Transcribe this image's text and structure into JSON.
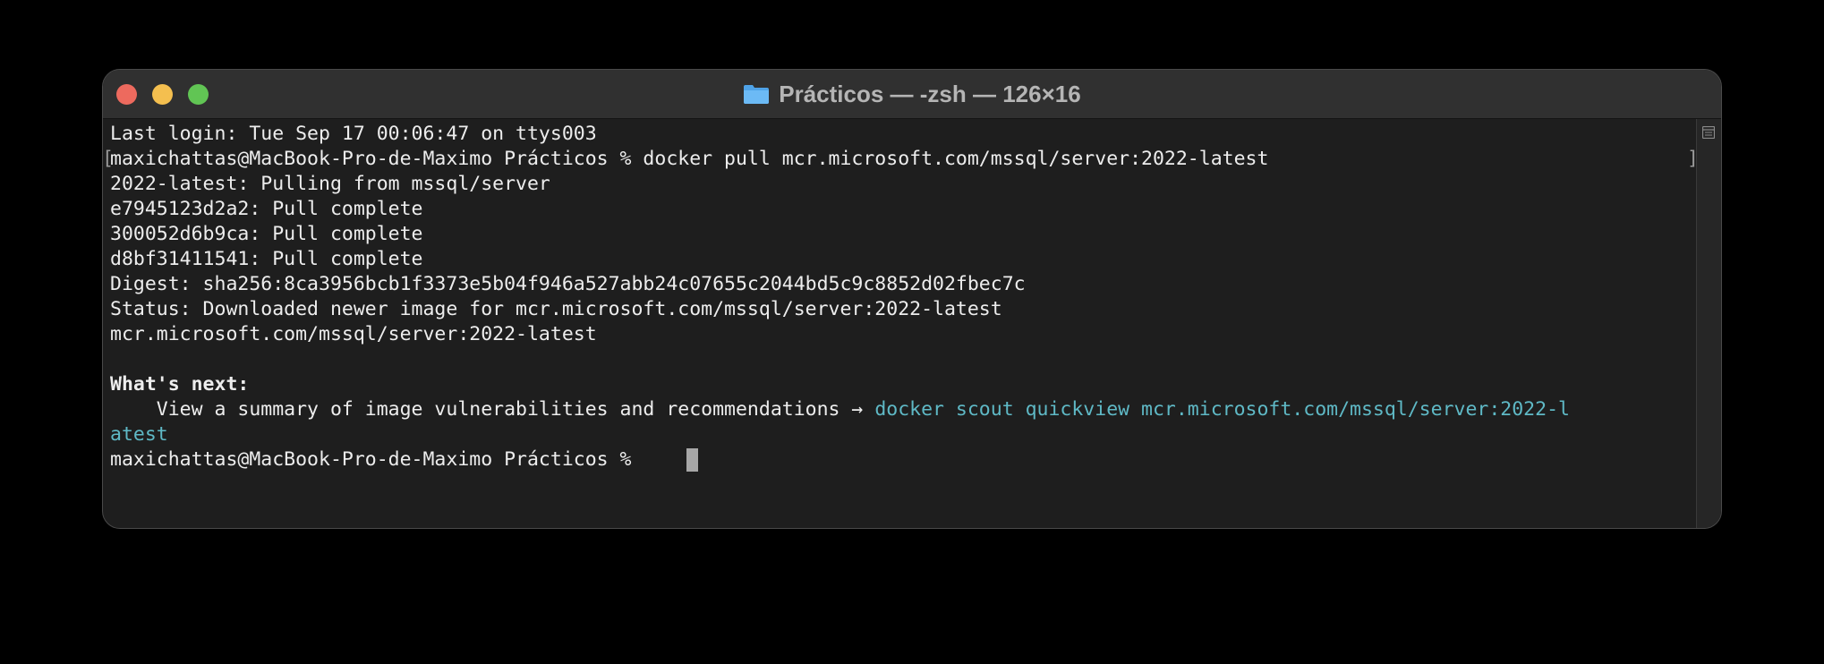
{
  "window": {
    "title": "Prácticos — -zsh — 126×16",
    "title_icon": "folder-icon"
  },
  "terminal": {
    "last_login": "Last login: Tue Sep 17 00:06:47 on ttys003",
    "command_line": "maxichattas@MacBook-Pro-de-Maximo Prácticos % docker pull mcr.microsoft.com/mssql/server:2022-latest",
    "output": [
      "2022-latest: Pulling from mssql/server",
      "e7945123d2a2: Pull complete",
      "300052d6b9ca: Pull complete",
      "d8bf31411541: Pull complete",
      "Digest: sha256:8ca3956bcb1f3373e5b04f946a527abb24c07655c2044bd5c9c8852d02fbec7c",
      "Status: Downloaded newer image for mcr.microsoft.com/mssql/server:2022-latest",
      "mcr.microsoft.com/mssql/server:2022-latest"
    ],
    "whats_next_heading": "What's next:",
    "hint_text": "    View a summary of image vulnerabilities and recommendations → ",
    "hint_command_part1": "docker scout quickview mcr.microsoft.com/mssql/server:2022-l",
    "hint_command_part2": "atest",
    "prompt": "maxichattas@MacBook-Pro-de-Maximo Prácticos % "
  },
  "colors": {
    "background": "#1e1e1e",
    "text": "#ededed",
    "link": "#5fb9c6",
    "cursor": "#a7a7a7"
  }
}
